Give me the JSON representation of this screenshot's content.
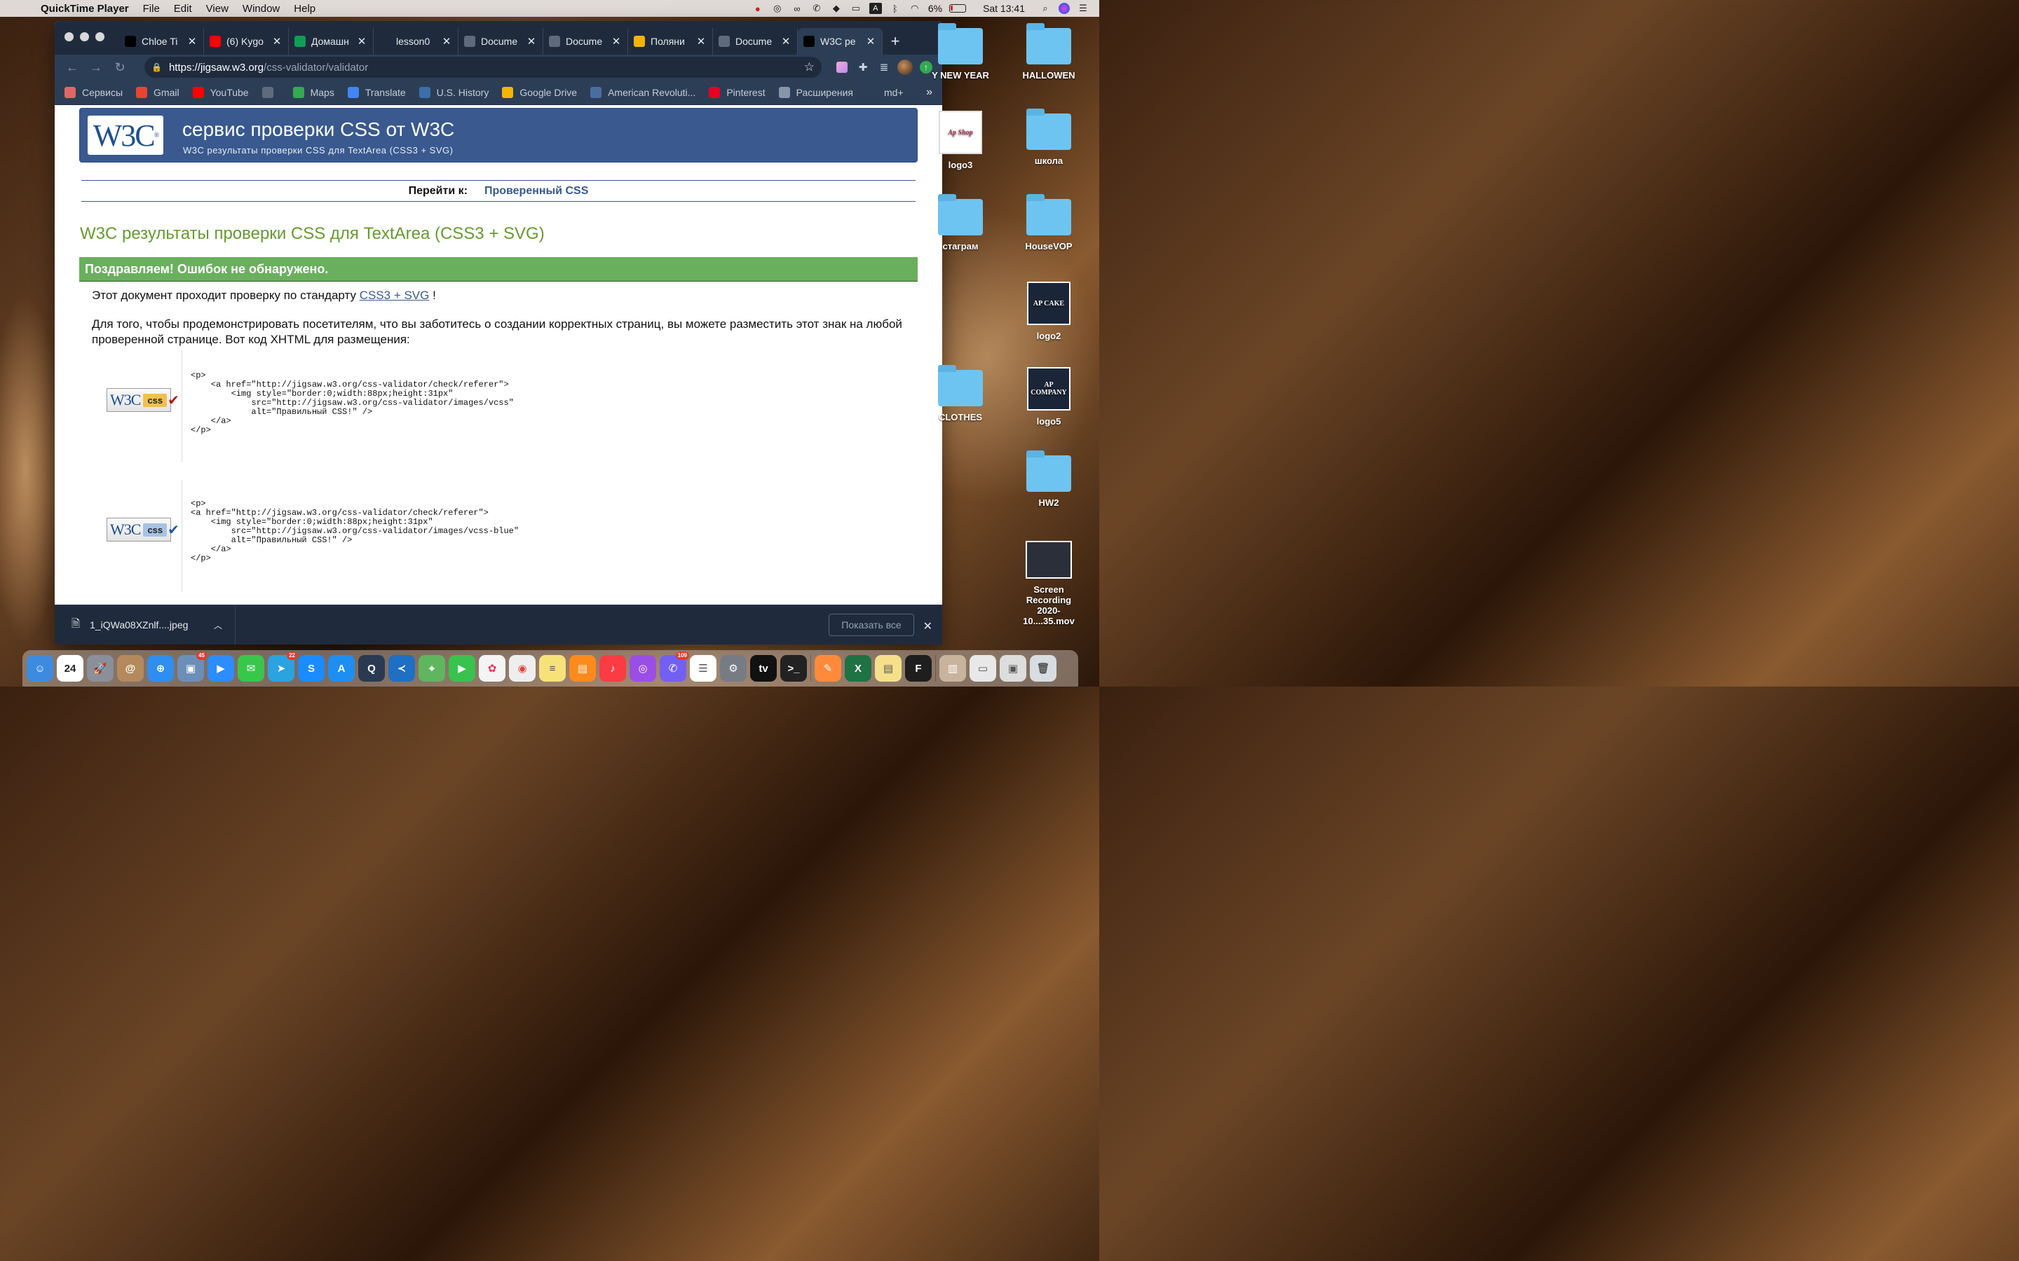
{
  "menubar": {
    "app": "QuickTime Player",
    "items": [
      "File",
      "Edit",
      "View",
      "Window",
      "Help"
    ],
    "battery": "6%",
    "clock": "Sat 13:41"
  },
  "tabs": [
    {
      "title": "Chloe Ti",
      "icon": "tiktok-icon",
      "color": "#000000"
    },
    {
      "title": "(6) Kygo",
      "icon": "youtube-icon",
      "color": "#ff0000"
    },
    {
      "title": "Домашн",
      "icon": "sheets-icon",
      "color": "#0f9d58"
    },
    {
      "title": "lesson0",
      "icon": "lambda-icon",
      "color": "#1f2b3d"
    },
    {
      "title": "Docume",
      "icon": "globe-icon",
      "color": "#5f6b7d"
    },
    {
      "title": "Docume",
      "icon": "globe-icon",
      "color": "#5f6b7d"
    },
    {
      "title": "Поляни",
      "icon": "drive-icon",
      "color": "#f4b400"
    },
    {
      "title": "Docume",
      "icon": "globe-icon",
      "color": "#5f6b7d"
    },
    {
      "title": "W3C pe",
      "icon": "w3c-icon",
      "color": "#000000"
    }
  ],
  "address": {
    "prefix": "https://",
    "host": "jigsaw.w3.org",
    "path": "/css-validator/validator"
  },
  "bookmarks": [
    {
      "label": "Сервисы",
      "icon": "apps-icon",
      "color": "#e06666"
    },
    {
      "label": "Gmail",
      "icon": "gmail-icon",
      "color": "#ea4335"
    },
    {
      "label": "YouTube",
      "icon": "youtube-icon",
      "color": "#ff0000"
    },
    {
      "label": "",
      "icon": "globe-icon",
      "color": "#5f6b7d"
    },
    {
      "label": "Maps",
      "icon": "maps-icon",
      "color": "#34a853"
    },
    {
      "label": "Translate",
      "icon": "translate-icon",
      "color": "#4285f4"
    },
    {
      "label": "U.S. History",
      "icon": "history-icon",
      "color": "#3c6ea8"
    },
    {
      "label": "Google Drive",
      "icon": "drive-icon",
      "color": "#f4b400"
    },
    {
      "label": "American Revoluti...",
      "icon": "revolution-icon",
      "color": "#4a6ea0"
    },
    {
      "label": "Pinterest",
      "icon": "pinterest-icon",
      "color": "#e60023"
    },
    {
      "label": "Расширения",
      "icon": "puzzle-icon",
      "color": "#8795a8"
    },
    {
      "label": "md+",
      "icon": "lambda-icon",
      "color": "#2c3e56"
    }
  ],
  "page": {
    "banner_title": "сервис проверки CSS от W3C",
    "banner_subtitle": "W3C результаты проверки CSS для TextArea (CSS3 + SVG)",
    "logo_text": "W3C",
    "jump_label": "Перейти к:",
    "jump_link": "Проверенный CSS",
    "results_title": "W3C результаты проверки CSS для TextArea (CSS3 + SVG)",
    "congrats": "Поздравляем! Ошибок не обнаружено.",
    "p1_before": "Этот документ проходит проверку по стандарту ",
    "p1_link": "CSS3 + SVG",
    "p1_after": " !",
    "p2": "Для того, чтобы продемонстрировать посетителям, что вы заботитесь о создании корректных страниц, вы можете разместить этот знак на любой проверенной странице. Вот код XHTML для размещения:",
    "badge_w3c": "W3C",
    "badge_css": "css",
    "code1": "<p>\n    <a href=\"http://jigsaw.w3.org/css-validator/check/referer\">\n        <img style=\"border:0;width:88px;height:31px\"\n            src=\"http://jigsaw.w3.org/css-validator/images/vcss\"\n            alt=\"Правильный CSS!\" />\n    </a>\n</p>",
    "code2": "<p>\n<a href=\"http://jigsaw.w3.org/css-validator/check/referer\">\n    <img style=\"border:0;width:88px;height:31px\"\n        src=\"http://jigsaw.w3.org/css-validator/images/vcss-blue\"\n        alt=\"Правильный CSS!\" />\n    </a>\n</p>"
  },
  "download": {
    "file": "1_iQWa08XZnlf....jpeg",
    "show_all": "Показать все"
  },
  "desktop": [
    {
      "label": "Y NEW YEAR",
      "kind": "folder"
    },
    {
      "label": "HALLOWEN",
      "kind": "folder"
    },
    {
      "label": "logo3",
      "kind": "thumb-white",
      "thumb_text": "Ap Shop"
    },
    {
      "label": "школа",
      "kind": "folder"
    },
    {
      "label": "стаграм",
      "kind": "folder"
    },
    {
      "label": "HouseVOP",
      "kind": "folder"
    },
    {
      "label": "logo2",
      "kind": "thumb",
      "thumb_text": "AP CAKE"
    },
    {
      "label": "CLOTHES",
      "kind": "folder"
    },
    {
      "label": "logo5",
      "kind": "thumb",
      "thumb_text": "AP COMPANY"
    },
    {
      "label": "HW2",
      "kind": "folder"
    },
    {
      "label": "Screen Recording 2020-10....35.mov",
      "kind": "screen"
    }
  ],
  "dock": [
    {
      "name": "finder",
      "color": "#3d8be0",
      "text": "☺"
    },
    {
      "name": "calendar",
      "color": "#ffffff",
      "text": "24",
      "fg": "#222"
    },
    {
      "name": "launchpad",
      "color": "#8a8f99",
      "text": "🚀"
    },
    {
      "name": "contacts",
      "color": "#b48a5c",
      "text": "@"
    },
    {
      "name": "safari",
      "color": "#2f8ef0",
      "text": "⊕"
    },
    {
      "name": "preview",
      "color": "#6b8fb8",
      "text": "▣",
      "badge": "45"
    },
    {
      "name": "zoom",
      "color": "#2d8cff",
      "text": "▶"
    },
    {
      "name": "messages",
      "color": "#38c74b",
      "text": "✉"
    },
    {
      "name": "telegram",
      "color": "#2aa3e0",
      "text": "➤",
      "badge": "22"
    },
    {
      "name": "shazam",
      "color": "#1a8cff",
      "text": "S"
    },
    {
      "name": "app-store",
      "color": "#1f8ef1",
      "text": "A"
    },
    {
      "name": "quicktime",
      "color": "#2a3a52",
      "text": "Q"
    },
    {
      "name": "vscode",
      "color": "#1f6fc2",
      "text": "≺"
    },
    {
      "name": "maps",
      "color": "#5fb65f",
      "text": "⌖"
    },
    {
      "name": "facetime",
      "color": "#3ac24e",
      "text": "▶"
    },
    {
      "name": "photos",
      "color": "#f4f4f4",
      "text": "✿",
      "fg": "#e35"
    },
    {
      "name": "chrome",
      "color": "#eeeeee",
      "text": "◉",
      "fg": "#db4437"
    },
    {
      "name": "notes",
      "color": "#f7e27a",
      "text": "≡",
      "fg": "#555"
    },
    {
      "name": "books",
      "color": "#ff8a1c",
      "text": "▤"
    },
    {
      "name": "music",
      "color": "#fc3c44",
      "text": "♪"
    },
    {
      "name": "podcasts",
      "color": "#9b4ee6",
      "text": "◎"
    },
    {
      "name": "viber",
      "color": "#7360f2",
      "text": "✆",
      "badge": "109"
    },
    {
      "name": "reminders",
      "color": "#ffffff",
      "text": "☰",
      "fg": "#555"
    },
    {
      "name": "system-preferences",
      "color": "#777c84",
      "text": "⚙"
    },
    {
      "name": "apple-tv",
      "color": "#111111",
      "text": "tv"
    },
    {
      "name": "terminal",
      "color": "#222222",
      "text": ">_"
    },
    {
      "name": "sep",
      "color": "",
      "text": ""
    },
    {
      "name": "pages-app",
      "color": "#ff8a3c",
      "text": "✎"
    },
    {
      "name": "excel",
      "color": "#1f7244",
      "text": "X"
    },
    {
      "name": "stickies",
      "color": "#f5e08a",
      "text": "▤",
      "fg": "#555"
    },
    {
      "name": "figma",
      "color": "#1e1e1e",
      "text": "F"
    },
    {
      "name": "sep",
      "color": "",
      "text": ""
    },
    {
      "name": "downloads-stack",
      "color": "#c8b49c",
      "text": "▥"
    },
    {
      "name": "document-stack",
      "color": "#e8e8e8",
      "text": "▭",
      "fg": "#555"
    },
    {
      "name": "screens-stack",
      "color": "#dddddd",
      "text": "▣",
      "fg": "#555"
    },
    {
      "name": "trash",
      "color": "#d8dde2",
      "text": "🗑",
      "fg": "#555"
    }
  ]
}
